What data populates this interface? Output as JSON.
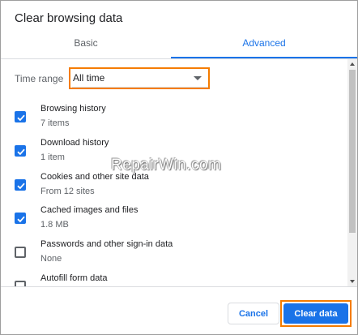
{
  "dialog": {
    "title": "Clear browsing data"
  },
  "tabs": [
    {
      "label": "Basic",
      "active": false
    },
    {
      "label": "Advanced",
      "active": true
    }
  ],
  "time_range": {
    "label": "Time range",
    "value": "All time"
  },
  "items": [
    {
      "title": "Browsing history",
      "subtitle": "7 items",
      "checked": true
    },
    {
      "title": "Download history",
      "subtitle": "1 item",
      "checked": true
    },
    {
      "title": "Cookies and other site data",
      "subtitle": "From 12 sites",
      "checked": true
    },
    {
      "title": "Cached images and files",
      "subtitle": "1.8 MB",
      "checked": true
    },
    {
      "title": "Passwords and other sign-in data",
      "subtitle": "None",
      "checked": false
    },
    {
      "title": "Autofill form data",
      "subtitle": "",
      "checked": false
    }
  ],
  "footer": {
    "cancel_label": "Cancel",
    "clear_label": "Clear data"
  },
  "watermark": "RepairWin.com",
  "colors": {
    "accent": "#1a73e8",
    "highlight": "#f57c00",
    "text": "#202124",
    "secondary_text": "#5f6368"
  }
}
